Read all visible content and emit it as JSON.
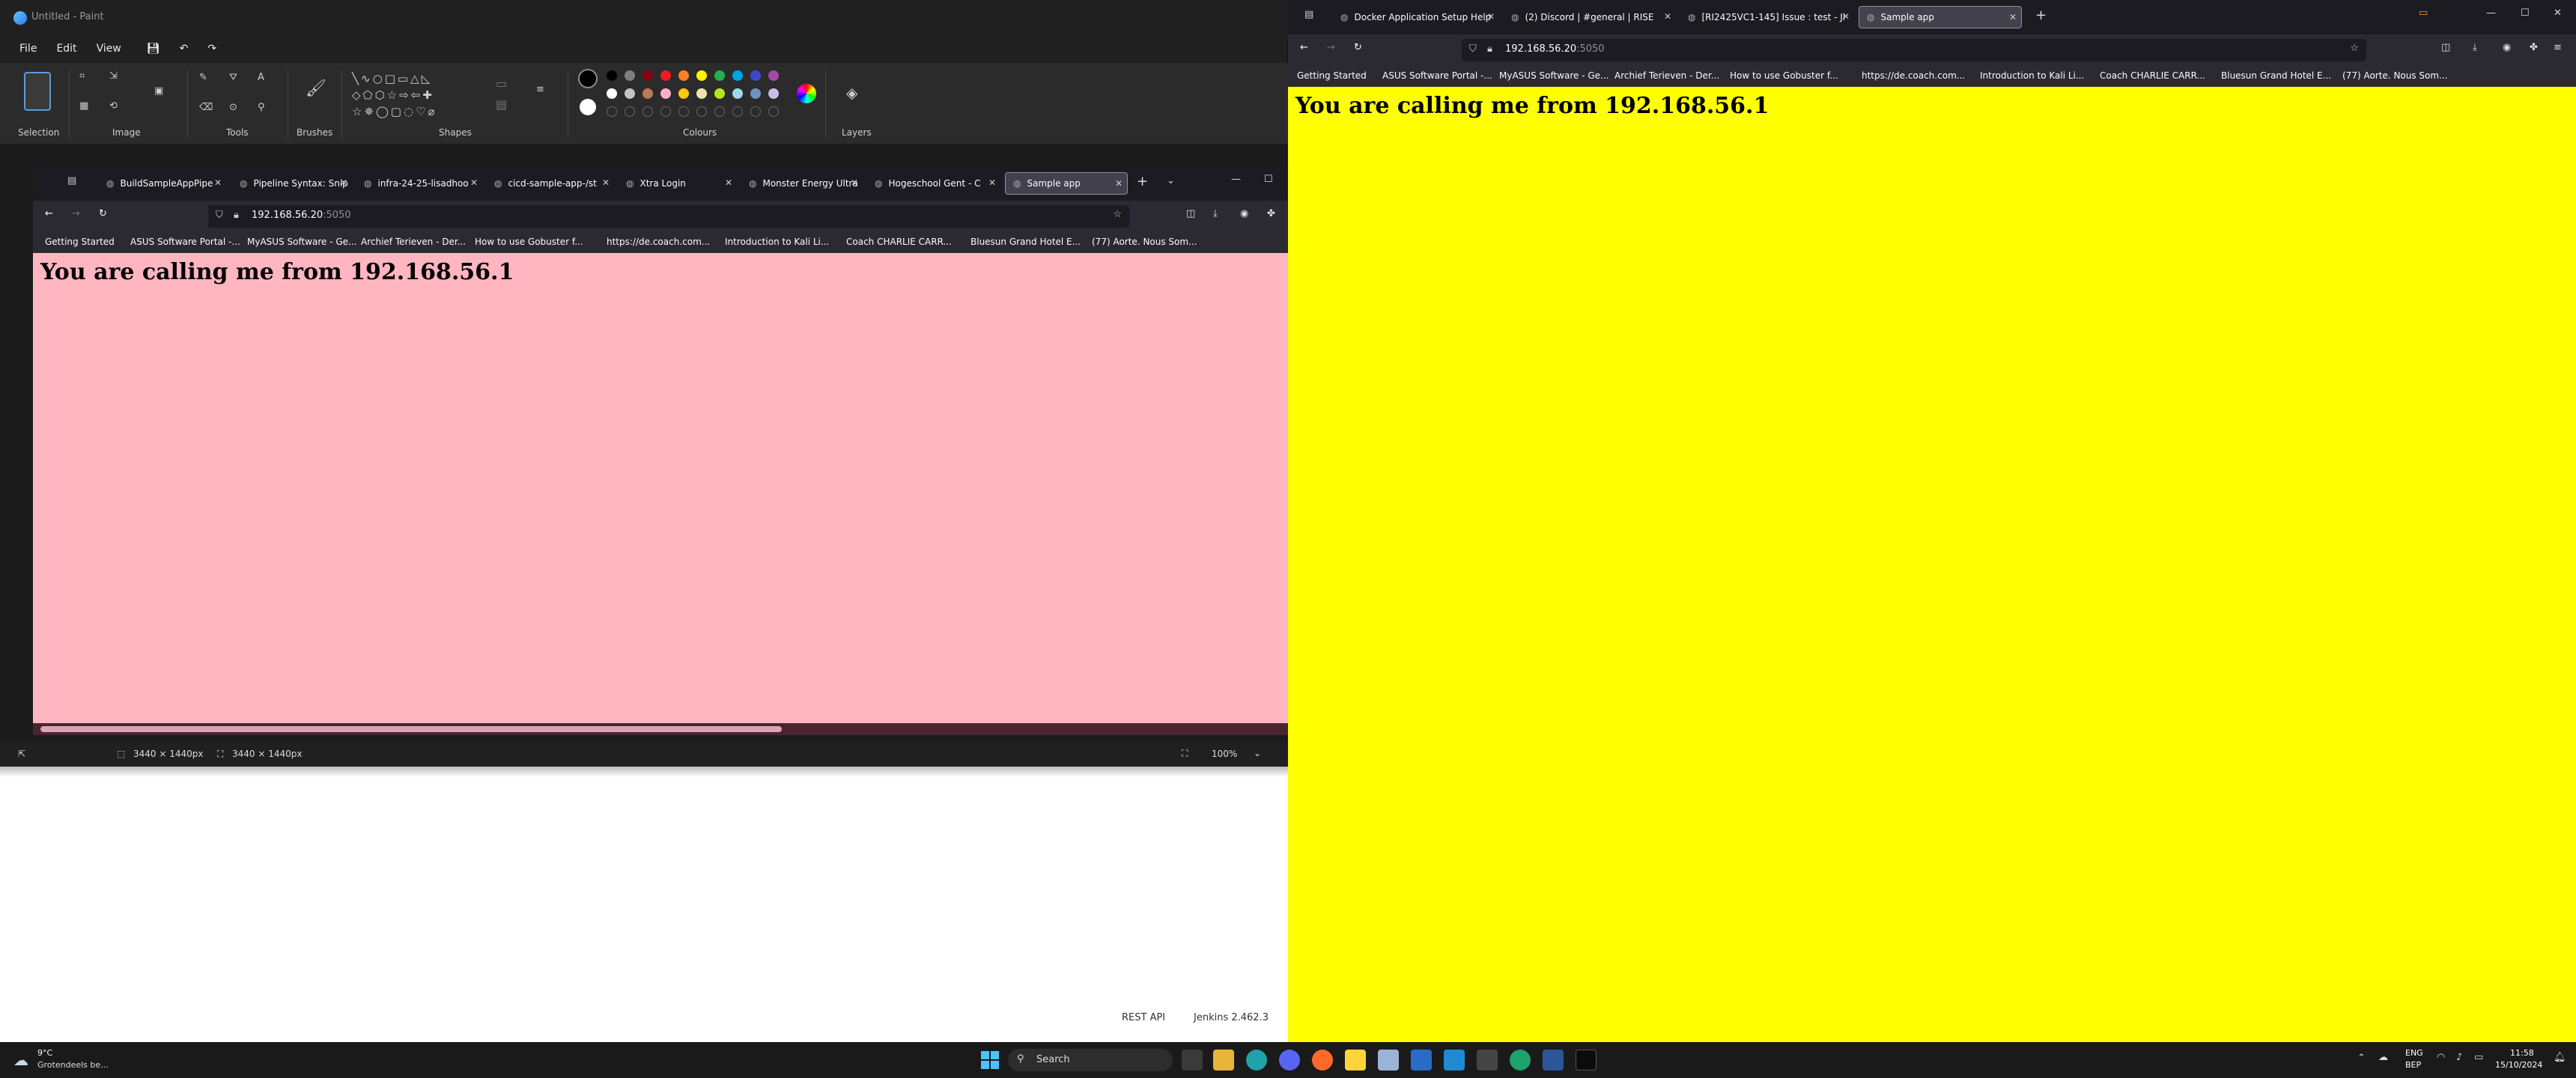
{
  "paint": {
    "title": "Untitled - Paint",
    "menu": [
      "File",
      "Edit",
      "View"
    ],
    "groups": {
      "selection": "Selection",
      "image": "Image",
      "tools": "Tools",
      "brushes": "Brushes",
      "shapes": "Shapes",
      "colours": "Colours",
      "layers": "Layers"
    },
    "status": {
      "selection_size": "3440 × 1440px",
      "canvas_size": "3440 × 1440px",
      "zoom": "100%"
    },
    "palette": [
      "#000000",
      "#7f7f7f",
      "#880015",
      "#ed1c24",
      "#ff7f27",
      "#fff200",
      "#22b14c",
      "#00a2e8",
      "#3f48cc",
      "#a349a4",
      "#ffffff",
      "#c3c3c3",
      "#b97a57",
      "#ffaec9",
      "#ffc90e",
      "#efe4b0",
      "#b5e61d",
      "#99d9ea",
      "#7092be",
      "#c8bfe7"
    ]
  },
  "left_browser": {
    "tabs": [
      {
        "label": "BuildSampleAppPipe"
      },
      {
        "label": "Pipeline Syntax: Snip"
      },
      {
        "label": "infra-24-25-lisadhoo"
      },
      {
        "label": "cicd-sample-app-/st"
      },
      {
        "label": "Xtra Login"
      },
      {
        "label": "Monster Energy Ultra"
      },
      {
        "label": "Hogeschool Gent - C"
      },
      {
        "label": "Sample app"
      }
    ],
    "url_host": "192.168.56.20",
    "url_port": ":5050",
    "bookmarks": [
      "Getting Started",
      "ASUS Software Portal -...",
      "MyASUS Software - Ge...",
      "Archief Terieven - Der...",
      "How to use Gobuster f...",
      "https://de.coach.com...",
      "Introduction to Kali Li...",
      "Coach CHARLIE CARR...",
      "Bluesun Grand Hotel E...",
      "(77) Aorte. Nous Som..."
    ],
    "page_text": "You are calling me from 192.168.56.1",
    "page_bg": "#ffb6c1"
  },
  "jenkins": {
    "rest_api": "REST API",
    "version": "Jenkins 2.462.3"
  },
  "right_browser": {
    "tabs": [
      {
        "label": "Docker Application Setup Help"
      },
      {
        "label": "(2) Discord | #general | RISE"
      },
      {
        "label": "[RI2425VC1-145] Issue : test - Ji"
      },
      {
        "label": "Sample app"
      }
    ],
    "url_host": "192.168.56.20",
    "url_port": ":5050",
    "bookmarks": [
      "Getting Started",
      "ASUS Software Portal -...",
      "MyASUS Software - Ge...",
      "Archief Terieven - Der...",
      "How to use Gobuster f...",
      "https://de.coach.com...",
      "Introduction to Kali Li...",
      "Coach CHARLIE CARR...",
      "Bluesun Grand Hotel E...",
      "(77) Aorte. Nous Som..."
    ],
    "page_text": "You are calling me from 192.168.56.1",
    "page_bg": "#ffff00"
  },
  "taskbar": {
    "weather_temp": "9°C",
    "weather_desc": "Grotendeels be...",
    "search": "Search",
    "lang": "ENG",
    "region": "BEP",
    "time": "11:58",
    "date": "15/10/2024"
  }
}
